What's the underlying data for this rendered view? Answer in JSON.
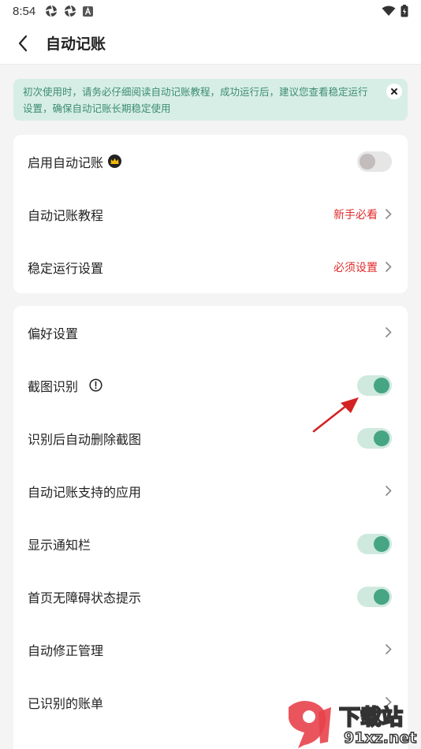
{
  "status_bar": {
    "time": "8:54",
    "left_icons": [
      "aperture-icon",
      "aperture-icon",
      "a-badge-icon"
    ],
    "right_icons": [
      "wifi-icon",
      "battery-icon"
    ]
  },
  "app_bar": {
    "title": "自动记账"
  },
  "notice": {
    "text": "初次使用时，请务必仔细阅读自动记账教程，成功运行后，建议您查看稳定运行设置，确保自动记账长期稳定使用"
  },
  "card1": {
    "rows": [
      {
        "label": "启用自动记账",
        "badge": "crown-icon",
        "toggle_on": false
      },
      {
        "label": "自动记账教程",
        "hint": "新手必看"
      },
      {
        "label": "稳定运行设置",
        "hint": "必须设置"
      }
    ]
  },
  "card2": {
    "rows": [
      {
        "label": "偏好设置"
      },
      {
        "label": "截图识别",
        "badge": "info-icon",
        "toggle_on": true
      },
      {
        "label": "识别后自动删除截图",
        "toggle_on": true
      },
      {
        "label": "自动记账支持的应用"
      },
      {
        "label": "显示通知栏",
        "toggle_on": true
      },
      {
        "label": "首页无障碍状态提示",
        "toggle_on": true
      },
      {
        "label": "自动修正管理"
      },
      {
        "label": "已识别的账单"
      }
    ]
  },
  "watermark": {
    "line1": "下载站",
    "line2": "91xz.net"
  },
  "colors": {
    "accent": "#46a584",
    "hint_red": "#e02b2b",
    "notice_bg": "#d7eee6",
    "notice_text": "#3d8c73"
  }
}
